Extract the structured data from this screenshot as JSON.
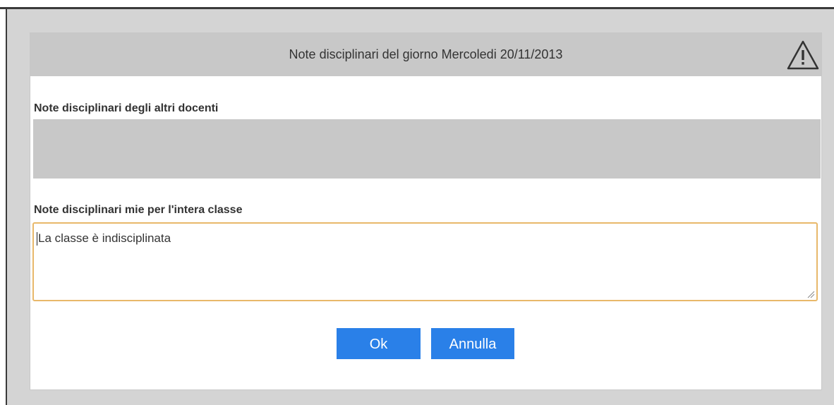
{
  "dialog": {
    "title": "Note disciplinari del giorno  Mercoledi 20/11/2013",
    "warning_icon": "warning-triangle-icon",
    "others_label": "Note disciplinari degli altri docenti",
    "mine_label": "Note disciplinari mie per l'intera classe",
    "mine_value": "La classe è indisciplinata",
    "ok_label": "Ok",
    "cancel_label": "Annulla"
  },
  "colors": {
    "header_bg": "#c8c8c8",
    "button_bg": "#2a80e8",
    "textarea_focus_border": "#e8b86a"
  }
}
